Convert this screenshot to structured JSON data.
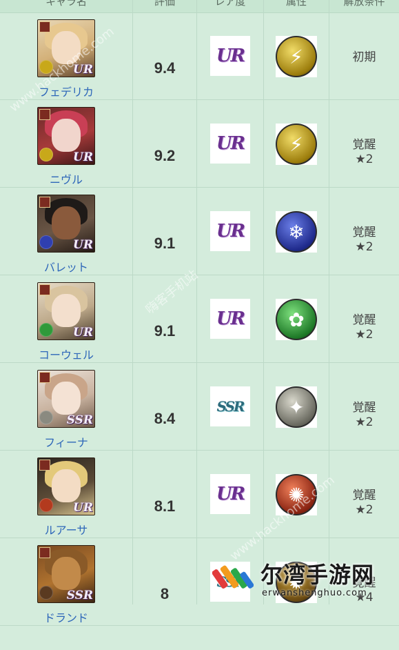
{
  "header": {
    "col1": "キャラ名",
    "col2": "評価",
    "col3": "レア度",
    "col4": "属性",
    "col5": "解放条件"
  },
  "rows": [
    {
      "name": "フェデリカ",
      "score": "9.4",
      "rarity": "UR",
      "element": "thunder",
      "cond1": "初期",
      "cond2": ""
    },
    {
      "name": "ニヴル",
      "score": "9.2",
      "rarity": "UR",
      "element": "thunder",
      "cond1": "覚醒",
      "cond2": "★2"
    },
    {
      "name": "バレット",
      "score": "9.1",
      "rarity": "UR",
      "element": "ice",
      "cond1": "覚醒",
      "cond2": "★2"
    },
    {
      "name": "コーウェル",
      "score": "9.1",
      "rarity": "UR",
      "element": "wind",
      "cond1": "覚醒",
      "cond2": "★2"
    },
    {
      "name": "フィーナ",
      "score": "8.4",
      "rarity": "SSR",
      "element": "light",
      "cond1": "覚醒",
      "cond2": "★2"
    },
    {
      "name": "ルアーサ",
      "score": "8.1",
      "rarity": "UR",
      "element": "fire",
      "cond1": "覚醒",
      "cond2": "★2"
    },
    {
      "name": "ドランド",
      "score": "8",
      "rarity": "SSR",
      "element": "dark",
      "cond1": "覚醒",
      "cond2": "★4"
    }
  ],
  "colors": {
    "thunder": "#c8a81a",
    "ice": "#2f3fb0",
    "wind": "#2f9a3a",
    "light": "#8a8a80",
    "fire": "#b33a1e",
    "dark": "#5a3a20"
  },
  "watermarks": {
    "w1": "www.hackhome.com",
    "w2": "嗨客手机站",
    "w3": "www.hackhome.com"
  },
  "brand": {
    "title": "尔湾手游网",
    "subtitle": "erwanshenghuo.com"
  }
}
